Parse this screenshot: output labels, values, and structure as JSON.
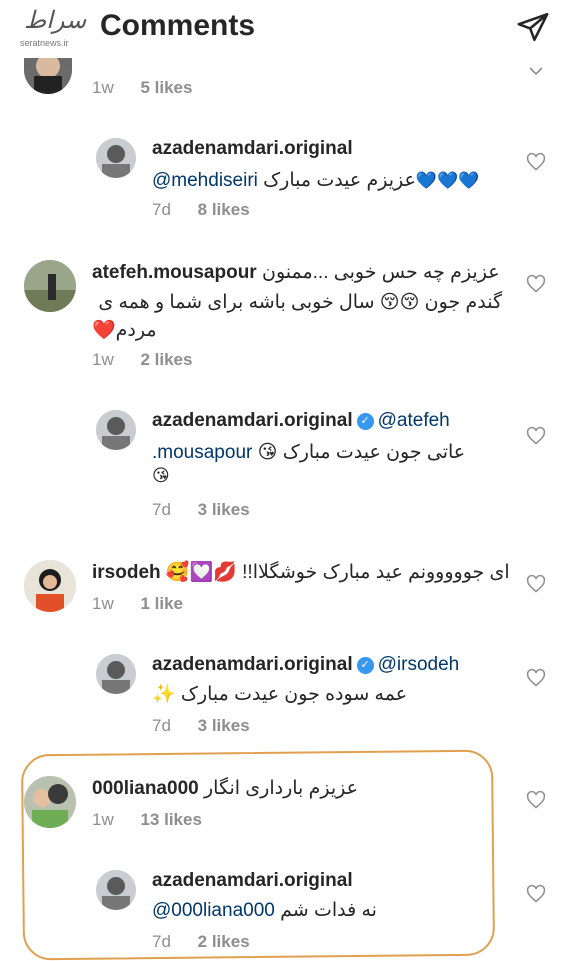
{
  "header": {
    "title": "Comments",
    "watermark_site": "seratnews.ir",
    "watermark_mark": "سراط"
  },
  "comments": [
    {
      "id": "c0",
      "age": "1w",
      "likes": "5 likes"
    },
    {
      "id": "r1",
      "author": "azadenamdari.original",
      "mention": "@mehdiseiri",
      "text": "عزیزم عیدت مبارک",
      "emoji": "💙💙💙",
      "age": "7d",
      "likes": "8 likes"
    },
    {
      "id": "c2",
      "author": "atefeh.mousapour",
      "line1": "عزیزم چه حس خوبی ...ممنون",
      "line2": "گندم جون 😚😚 سال خوبی باشه برای شما و همه ی",
      "line3": "مردم❤️",
      "age": "1w",
      "likes": "2 likes"
    },
    {
      "id": "r3",
      "author": "azadenamdari.original",
      "mention": "@atefeh",
      "mention2": ".mousapour",
      "text": "عاتی جون عیدت مبارک 😘",
      "emoji2": "😘",
      "age": "7d",
      "likes": "3 likes"
    },
    {
      "id": "c4",
      "author": "irsodeh",
      "text": "ای جووووونم عید مبارک خوشگلاا!! 💋💟🥰",
      "age": "1w",
      "likes": "1 like"
    },
    {
      "id": "r5",
      "author": "azadenamdari.original",
      "mention": "@irsodeh",
      "text": "عمه سوده جون عیدت مبارک ✨",
      "age": "7d",
      "likes": "3 likes"
    },
    {
      "id": "c6",
      "author": "000liana000",
      "text": "عزیزم بارداری انگار",
      "age": "1w",
      "likes": "13 likes"
    },
    {
      "id": "r7",
      "author": "azadenamdari.original",
      "mention": "@000liana000",
      "text": "نه فدات شم",
      "age": "7d",
      "likes": "2 likes"
    }
  ],
  "colors": {
    "mention": "#00376b",
    "meta": "#8e8e8e",
    "verified": "#3897f0",
    "highlight": "#e0a050"
  }
}
